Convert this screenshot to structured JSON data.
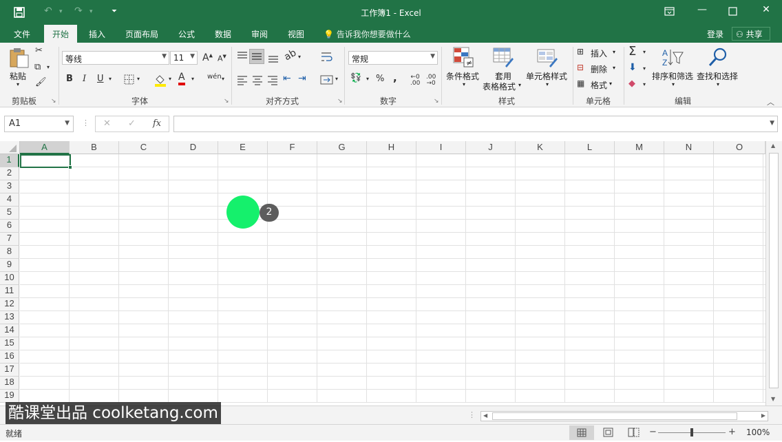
{
  "titlebar": {
    "title": "工作簿1 - Excel",
    "save_icon": "save-icon",
    "undo_icon": "undo-icon",
    "redo_icon": "redo-icon",
    "customize_icon": "customize-qat-icon"
  },
  "tabs": [
    "文件",
    "开始",
    "插入",
    "页面布局",
    "公式",
    "数据",
    "审阅",
    "视图"
  ],
  "active_tab": "开始",
  "tellme": "告诉我你想要做什么",
  "login": "登录",
  "share": "共享",
  "ribbon": {
    "clipboard": {
      "paste": "粘贴",
      "label": "剪贴板"
    },
    "font": {
      "name": "等线",
      "size": "11",
      "bold": "B",
      "italic": "I",
      "underline": "U",
      "label": "字体",
      "grow": "A",
      "shrink": "A",
      "phonetic": "wén"
    },
    "alignment": {
      "label": "对齐方式"
    },
    "number": {
      "format": "常规",
      "percent": "%",
      "comma": ",",
      "label": "数字"
    },
    "styles": {
      "conditional": "条件格式",
      "table1": "套用",
      "table2": "表格格式",
      "cell_styles": "单元格样式",
      "label": "样式"
    },
    "cells": {
      "insert": "插入",
      "delete": "删除",
      "format": "格式",
      "label": "单元格"
    },
    "editing": {
      "sort_filter": "排序和筛选",
      "find_select": "查找和选择",
      "label": "编辑"
    }
  },
  "formula_bar": {
    "name_box": "A1",
    "fx": "fx",
    "cancel": "✕",
    "enter": "✓"
  },
  "columns": [
    "A",
    "B",
    "C",
    "D",
    "E",
    "F",
    "G",
    "H",
    "I",
    "J",
    "K",
    "L",
    "M",
    "N",
    "O"
  ],
  "rows": [
    "1",
    "2",
    "3",
    "4",
    "5",
    "6",
    "7",
    "8",
    "9",
    "10",
    "11",
    "12",
    "13",
    "14",
    "15",
    "16",
    "17",
    "18",
    "19"
  ],
  "selected_cell": "A1",
  "status": {
    "ready": "就绪",
    "zoom": "100%",
    "zoom_minus": "−",
    "zoom_plus": "+"
  },
  "overlay": {
    "step_badge": "2",
    "watermark": "酷课堂出品 coolketang.com"
  },
  "colors": {
    "brand": "#217346",
    "click_marker": "#15f06c"
  }
}
